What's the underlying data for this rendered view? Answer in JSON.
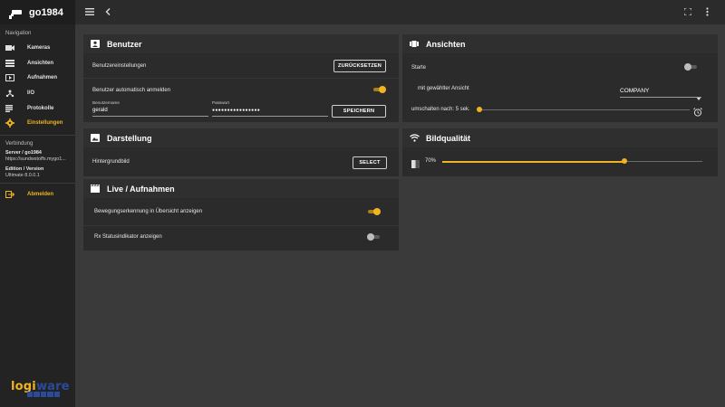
{
  "app": {
    "title": "go1984"
  },
  "sidebar": {
    "nav_heading": "Navigation",
    "items": [
      {
        "label": "Kameras",
        "icon": "camera-icon"
      },
      {
        "label": "Ansichten",
        "icon": "view-icon"
      },
      {
        "label": "Aufnahmen",
        "icon": "video-icon"
      },
      {
        "label": "I/O",
        "icon": "network-icon"
      },
      {
        "label": "Protokolle",
        "icon": "list-icon"
      },
      {
        "label": "Einstellungen",
        "icon": "gear-icon"
      }
    ],
    "connection_heading": "Verbindung",
    "server_label": "Server / go1984",
    "server_value": "https://sundwstoffs.mygo1...",
    "edition_label": "Edition / Version",
    "edition_value": "Ultimate  8.0.0.1",
    "logout_label": "Abmelden",
    "brand_logo": {
      "part1": "logi",
      "part2": "ware"
    }
  },
  "benutzer": {
    "title": "Benutzer",
    "settings_label": "Benutzereinstellungen",
    "reset_button": "ZURÜCKSETZEN",
    "auto_login_label": "Benutzer automatisch anmelden",
    "auto_login": true,
    "username_label": "Benutzername",
    "username_value": "gerald",
    "password_label": "Passwort",
    "password_value": "●●●●●●●●●●●●●●●●",
    "save_button": "SPEICHERN"
  },
  "darstellung": {
    "title": "Darstellung",
    "background_label": "Hintergrundbild",
    "select_button": "SELECT"
  },
  "live": {
    "title": "Live / Aufnahmen",
    "motion_label": "Bewegungserkennung in Übersicht anzeigen",
    "motion": true,
    "rx_label": "Rx Statusindikator anzeigen",
    "rx": false
  },
  "ansichten": {
    "title": "Ansichten",
    "start_label": "Starte",
    "start": false,
    "view_label": "mit gewählter Ansicht",
    "view_value": "COMPANY",
    "switch_label": "umschalten nach: 5 sek.",
    "switch_level": 0.0
  },
  "bildqualitaet": {
    "title": "Bildqualität",
    "value_label": "70%",
    "level": 0.7
  },
  "colors": {
    "accent": "#f0b323",
    "panel": "#2b2b2b",
    "background": "#3a3a3a",
    "sidebar": "#232323"
  }
}
